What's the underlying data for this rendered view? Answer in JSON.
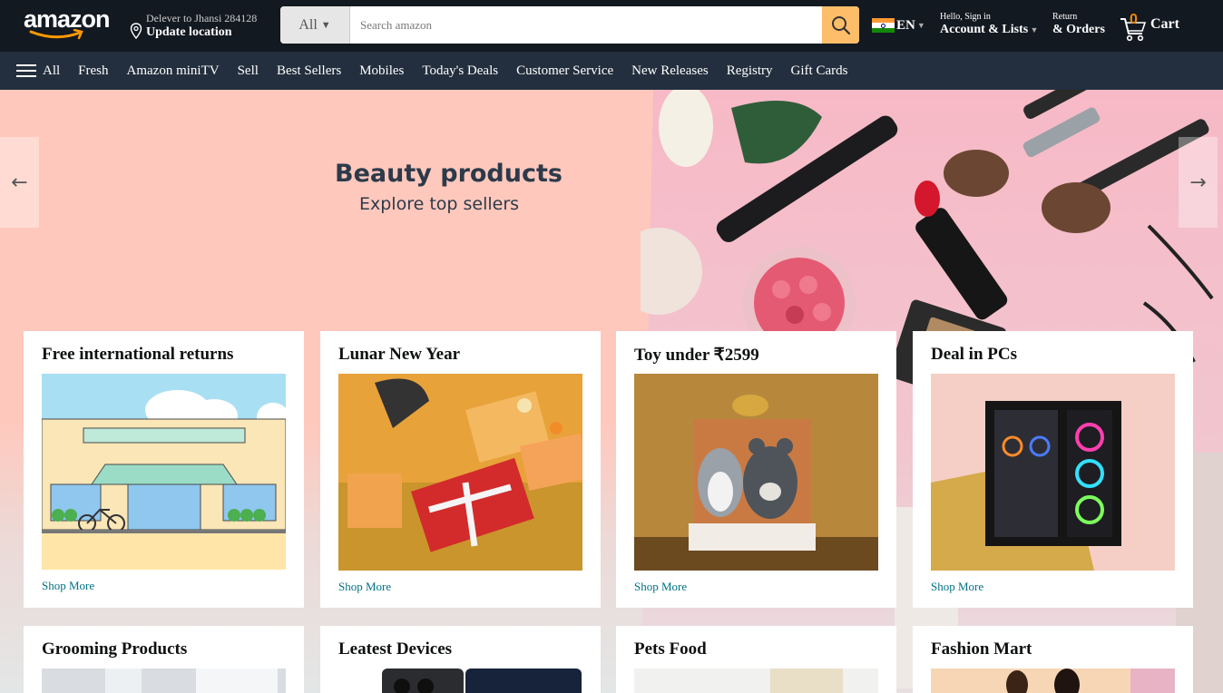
{
  "header": {
    "logo_text": "amazon",
    "deliver_line1": "Delever to Jhansi 284128",
    "deliver_line2": "Update location",
    "search": {
      "category": "All",
      "placeholder": "Search amazon"
    },
    "language": "EN",
    "account_line1": "Hello, Sign in",
    "account_line2": "Account & Lists",
    "orders_line1": "Return",
    "orders_line2": "& Orders",
    "cart_count": "0",
    "cart_label": "Cart"
  },
  "subnav": {
    "all_label": "All",
    "items": [
      "Fresh",
      "Amazon miniTV",
      "Sell",
      "Best Sellers",
      "Mobiles",
      "Today's Deals",
      "Customer Service",
      "New Releases",
      "Registry",
      "Gift Cards"
    ]
  },
  "hero": {
    "title": "Beauty products",
    "subtitle": "Explore top sellers",
    "prev_arrow": "←",
    "next_arrow": "→"
  },
  "cards": [
    {
      "title": "Free international returns",
      "link": "Shop More",
      "image": "storefront-illustration"
    },
    {
      "title": "Lunar New Year",
      "link": "Shop More",
      "image": "gift-boxes-photo"
    },
    {
      "title": "Toy under ₹2599",
      "link": "Shop More",
      "image": "plush-toys-photo"
    },
    {
      "title": "Deal in PCs",
      "link": "Shop More",
      "image": "gaming-pc-photo"
    },
    {
      "title": "Grooming Products",
      "image": "grooming-photo"
    },
    {
      "title": "Leatest Devices",
      "image": "smartphone-photo"
    },
    {
      "title": "Pets Food",
      "image": "pet-food-photo"
    },
    {
      "title": "Fashion Mart",
      "image": "fashion-photo"
    }
  ],
  "colors": {
    "nav_dark": "#131921",
    "nav_sub": "#232f3e",
    "search_button": "#febd69",
    "cart_count": "#f08804",
    "link": "#007185",
    "hero_bg": "#ffc8bd"
  }
}
